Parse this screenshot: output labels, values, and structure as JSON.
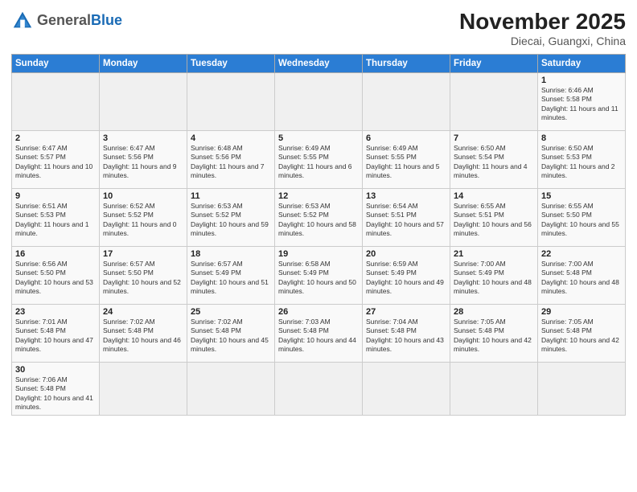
{
  "header": {
    "logo_general": "General",
    "logo_blue": "Blue",
    "month_title": "November 2025",
    "location": "Diecai, Guangxi, China"
  },
  "weekdays": [
    "Sunday",
    "Monday",
    "Tuesday",
    "Wednesday",
    "Thursday",
    "Friday",
    "Saturday"
  ],
  "weeks": [
    [
      null,
      null,
      null,
      null,
      null,
      null,
      {
        "day": "1",
        "sunrise": "6:46 AM",
        "sunset": "5:58 PM",
        "daylight": "11 hours and 11 minutes."
      }
    ],
    [
      {
        "day": "2",
        "sunrise": "6:47 AM",
        "sunset": "5:57 PM",
        "daylight": "11 hours and 10 minutes."
      },
      {
        "day": "3",
        "sunrise": "6:47 AM",
        "sunset": "5:56 PM",
        "daylight": "11 hours and 9 minutes."
      },
      {
        "day": "4",
        "sunrise": "6:48 AM",
        "sunset": "5:56 PM",
        "daylight": "11 hours and 7 minutes."
      },
      {
        "day": "5",
        "sunrise": "6:49 AM",
        "sunset": "5:55 PM",
        "daylight": "11 hours and 6 minutes."
      },
      {
        "day": "6",
        "sunrise": "6:49 AM",
        "sunset": "5:55 PM",
        "daylight": "11 hours and 5 minutes."
      },
      {
        "day": "7",
        "sunrise": "6:50 AM",
        "sunset": "5:54 PM",
        "daylight": "11 hours and 4 minutes."
      },
      {
        "day": "8",
        "sunrise": "6:50 AM",
        "sunset": "5:53 PM",
        "daylight": "11 hours and 2 minutes."
      }
    ],
    [
      {
        "day": "9",
        "sunrise": "6:51 AM",
        "sunset": "5:53 PM",
        "daylight": "11 hours and 1 minute."
      },
      {
        "day": "10",
        "sunrise": "6:52 AM",
        "sunset": "5:52 PM",
        "daylight": "11 hours and 0 minutes."
      },
      {
        "day": "11",
        "sunrise": "6:53 AM",
        "sunset": "5:52 PM",
        "daylight": "10 hours and 59 minutes."
      },
      {
        "day": "12",
        "sunrise": "6:53 AM",
        "sunset": "5:52 PM",
        "daylight": "10 hours and 58 minutes."
      },
      {
        "day": "13",
        "sunrise": "6:54 AM",
        "sunset": "5:51 PM",
        "daylight": "10 hours and 57 minutes."
      },
      {
        "day": "14",
        "sunrise": "6:55 AM",
        "sunset": "5:51 PM",
        "daylight": "10 hours and 56 minutes."
      },
      {
        "day": "15",
        "sunrise": "6:55 AM",
        "sunset": "5:50 PM",
        "daylight": "10 hours and 55 minutes."
      }
    ],
    [
      {
        "day": "16",
        "sunrise": "6:56 AM",
        "sunset": "5:50 PM",
        "daylight": "10 hours and 53 minutes."
      },
      {
        "day": "17",
        "sunrise": "6:57 AM",
        "sunset": "5:50 PM",
        "daylight": "10 hours and 52 minutes."
      },
      {
        "day": "18",
        "sunrise": "6:57 AM",
        "sunset": "5:49 PM",
        "daylight": "10 hours and 51 minutes."
      },
      {
        "day": "19",
        "sunrise": "6:58 AM",
        "sunset": "5:49 PM",
        "daylight": "10 hours and 50 minutes."
      },
      {
        "day": "20",
        "sunrise": "6:59 AM",
        "sunset": "5:49 PM",
        "daylight": "10 hours and 49 minutes."
      },
      {
        "day": "21",
        "sunrise": "7:00 AM",
        "sunset": "5:49 PM",
        "daylight": "10 hours and 48 minutes."
      },
      {
        "day": "22",
        "sunrise": "7:00 AM",
        "sunset": "5:48 PM",
        "daylight": "10 hours and 48 minutes."
      }
    ],
    [
      {
        "day": "23",
        "sunrise": "7:01 AM",
        "sunset": "5:48 PM",
        "daylight": "10 hours and 47 minutes."
      },
      {
        "day": "24",
        "sunrise": "7:02 AM",
        "sunset": "5:48 PM",
        "daylight": "10 hours and 46 minutes."
      },
      {
        "day": "25",
        "sunrise": "7:02 AM",
        "sunset": "5:48 PM",
        "daylight": "10 hours and 45 minutes."
      },
      {
        "day": "26",
        "sunrise": "7:03 AM",
        "sunset": "5:48 PM",
        "daylight": "10 hours and 44 minutes."
      },
      {
        "day": "27",
        "sunrise": "7:04 AM",
        "sunset": "5:48 PM",
        "daylight": "10 hours and 43 minutes."
      },
      {
        "day": "28",
        "sunrise": "7:05 AM",
        "sunset": "5:48 PM",
        "daylight": "10 hours and 42 minutes."
      },
      {
        "day": "29",
        "sunrise": "7:05 AM",
        "sunset": "5:48 PM",
        "daylight": "10 hours and 42 minutes."
      }
    ],
    [
      {
        "day": "30",
        "sunrise": "7:06 AM",
        "sunset": "5:48 PM",
        "daylight": "10 hours and 41 minutes."
      },
      null,
      null,
      null,
      null,
      null,
      null
    ]
  ]
}
